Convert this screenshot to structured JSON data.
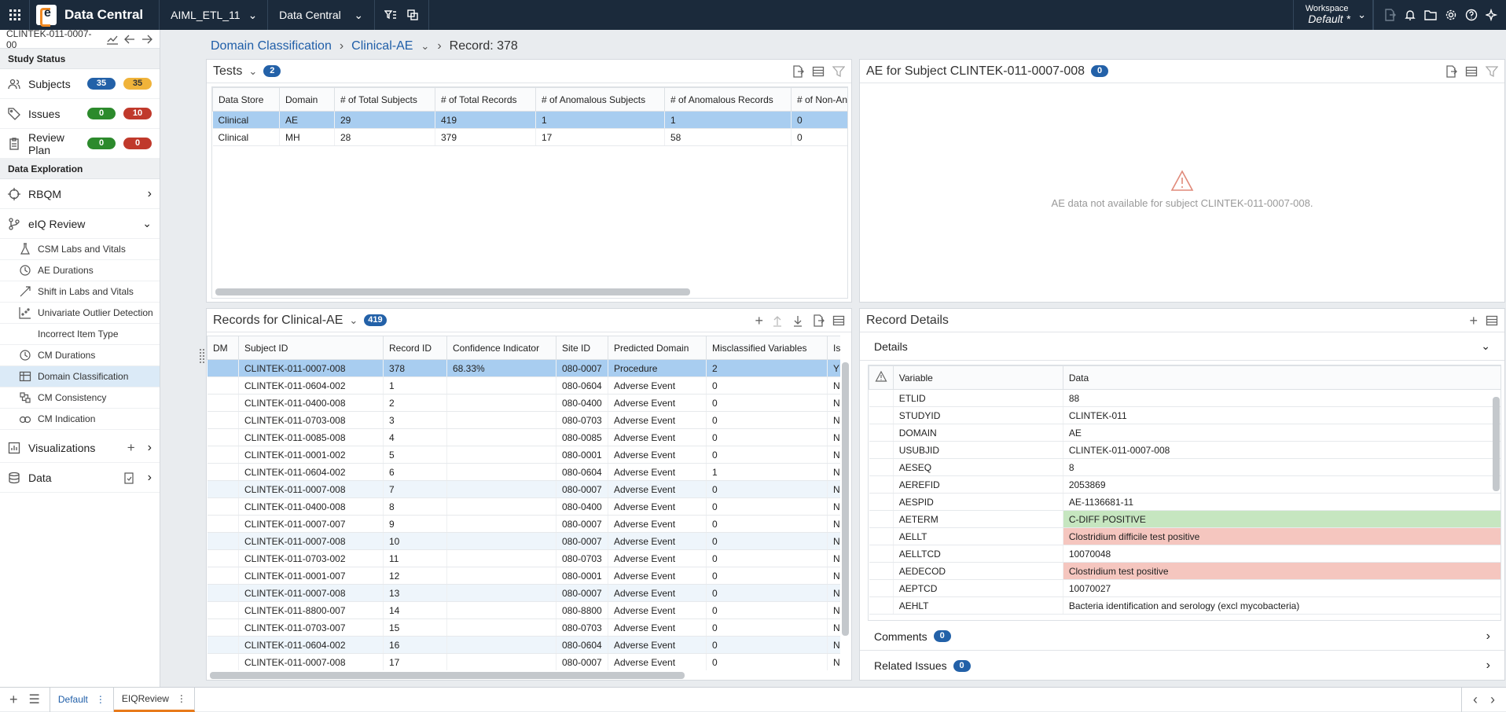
{
  "topbar": {
    "app_title": "Data Central",
    "study": "AIML_ETL_11",
    "module": "Data Central",
    "workspace_label": "Workspace",
    "workspace_value": "Default",
    "workspace_mark": "*"
  },
  "sidebar": {
    "subject": "CLINTEK-011-0007-00",
    "study_status": "Study Status",
    "rows": [
      {
        "label": "Subjects",
        "a": "35",
        "b": "35"
      },
      {
        "label": "Issues",
        "a": "0",
        "b": "10"
      },
      {
        "label": "Review Plan",
        "a": "0",
        "b": "0"
      }
    ],
    "data_exploration": "Data Exploration",
    "rbqm": "RBQM",
    "eiq": "eIQ Review",
    "sub_items": [
      "CSM Labs and Vitals",
      "AE Durations",
      "Shift in Labs and Vitals",
      "Univariate Outlier Detection",
      "Incorrect Item Type",
      "CM Durations",
      "Domain Classification",
      "CM Consistency",
      "CM Indication"
    ],
    "visualizations": "Visualizations",
    "data": "Data"
  },
  "breadcrumb": {
    "c1": "Domain Classification",
    "c2": "Clinical-AE",
    "c3": "Record: 378"
  },
  "tests": {
    "title": "Tests",
    "count": "2",
    "headers": [
      "Data Store",
      "Domain",
      "# of Total Subjects",
      "# of Total Records",
      "# of Anomalous Subjects",
      "# of Anomalous Records",
      "# of Non-An"
    ],
    "rows": [
      [
        "Clinical",
        "AE",
        "29",
        "419",
        "1",
        "1",
        "0"
      ],
      [
        "Clinical",
        "MH",
        "28",
        "379",
        "17",
        "58",
        "0"
      ]
    ]
  },
  "ae_panel": {
    "title": "AE for Subject CLINTEK-011-0007-008",
    "count": "0",
    "message": "AE data not available for subject CLINTEK-011-0007-008."
  },
  "records": {
    "title": "Records for Clinical-AE",
    "count": "419",
    "headers": [
      "DM",
      "Subject ID",
      "Record ID",
      "Confidence Indicator",
      "Site ID",
      "Predicted Domain",
      "Misclassified Variables",
      "Is Anomal"
    ],
    "rows": [
      [
        "",
        "CLINTEK-011-0007-008",
        "378",
        "68.33%",
        "080-0007",
        "Procedure",
        "2",
        "Y"
      ],
      [
        "",
        "CLINTEK-011-0604-002",
        "1",
        "",
        "080-0604",
        "Adverse Event",
        "0",
        "N"
      ],
      [
        "",
        "CLINTEK-011-0400-008",
        "2",
        "",
        "080-0400",
        "Adverse Event",
        "0",
        "N"
      ],
      [
        "",
        "CLINTEK-011-0703-008",
        "3",
        "",
        "080-0703",
        "Adverse Event",
        "0",
        "N"
      ],
      [
        "",
        "CLINTEK-011-0085-008",
        "4",
        "",
        "080-0085",
        "Adverse Event",
        "0",
        "N"
      ],
      [
        "",
        "CLINTEK-011-0001-002",
        "5",
        "",
        "080-0001",
        "Adverse Event",
        "0",
        "N"
      ],
      [
        "",
        "CLINTEK-011-0604-002",
        "6",
        "",
        "080-0604",
        "Adverse Event",
        "1",
        "N"
      ],
      [
        "",
        "CLINTEK-011-0007-008",
        "7",
        "",
        "080-0007",
        "Adverse Event",
        "0",
        "N"
      ],
      [
        "",
        "CLINTEK-011-0400-008",
        "8",
        "",
        "080-0400",
        "Adverse Event",
        "0",
        "N"
      ],
      [
        "",
        "CLINTEK-011-0007-007",
        "9",
        "",
        "080-0007",
        "Adverse Event",
        "0",
        "N"
      ],
      [
        "",
        "CLINTEK-011-0007-008",
        "10",
        "",
        "080-0007",
        "Adverse Event",
        "0",
        "N"
      ],
      [
        "",
        "CLINTEK-011-0703-002",
        "11",
        "",
        "080-0703",
        "Adverse Event",
        "0",
        "N"
      ],
      [
        "",
        "CLINTEK-011-0001-007",
        "12",
        "",
        "080-0001",
        "Adverse Event",
        "0",
        "N"
      ],
      [
        "",
        "CLINTEK-011-0007-008",
        "13",
        "",
        "080-0007",
        "Adverse Event",
        "0",
        "N"
      ],
      [
        "",
        "CLINTEK-011-8800-007",
        "14",
        "",
        "080-8800",
        "Adverse Event",
        "0",
        "N"
      ],
      [
        "",
        "CLINTEK-011-0703-007",
        "15",
        "",
        "080-0703",
        "Adverse Event",
        "0",
        "N"
      ],
      [
        "",
        "CLINTEK-011-0604-002",
        "16",
        "",
        "080-0604",
        "Adverse Event",
        "0",
        "N"
      ],
      [
        "",
        "CLINTEK-011-0007-008",
        "17",
        "",
        "080-0007",
        "Adverse Event",
        "0",
        "N"
      ]
    ]
  },
  "details": {
    "title": "Record Details",
    "section": "Details",
    "headers": [
      "Variable",
      "Data"
    ],
    "rows": [
      {
        "v": "ETLID",
        "d": "88",
        "h": ""
      },
      {
        "v": "STUDYID",
        "d": "CLINTEK-011",
        "h": ""
      },
      {
        "v": "DOMAIN",
        "d": "AE",
        "h": ""
      },
      {
        "v": "USUBJID",
        "d": "CLINTEK-011-0007-008",
        "h": ""
      },
      {
        "v": "AESEQ",
        "d": "8",
        "h": ""
      },
      {
        "v": "AEREFID",
        "d": "2053869",
        "h": ""
      },
      {
        "v": "AESPID",
        "d": "AE-1136681-11",
        "h": ""
      },
      {
        "v": "AETERM",
        "d": "C-DIFF POSITIVE",
        "h": "g"
      },
      {
        "v": "AELLT",
        "d": "Clostridium difficile test positive",
        "h": "r"
      },
      {
        "v": "AELLTCD",
        "d": "10070048",
        "h": ""
      },
      {
        "v": "AEDECOD",
        "d": "Clostridium test positive",
        "h": "r"
      },
      {
        "v": "AEPTCD",
        "d": "10070027",
        "h": ""
      },
      {
        "v": "AEHLT",
        "d": "Bacteria identification and serology (excl mycobacteria)",
        "h": ""
      }
    ],
    "comments": "Comments",
    "comments_count": "0",
    "related": "Related Issues",
    "related_count": "0"
  },
  "bottombar": {
    "tab1": "Default",
    "tab2": "EIQReview"
  }
}
